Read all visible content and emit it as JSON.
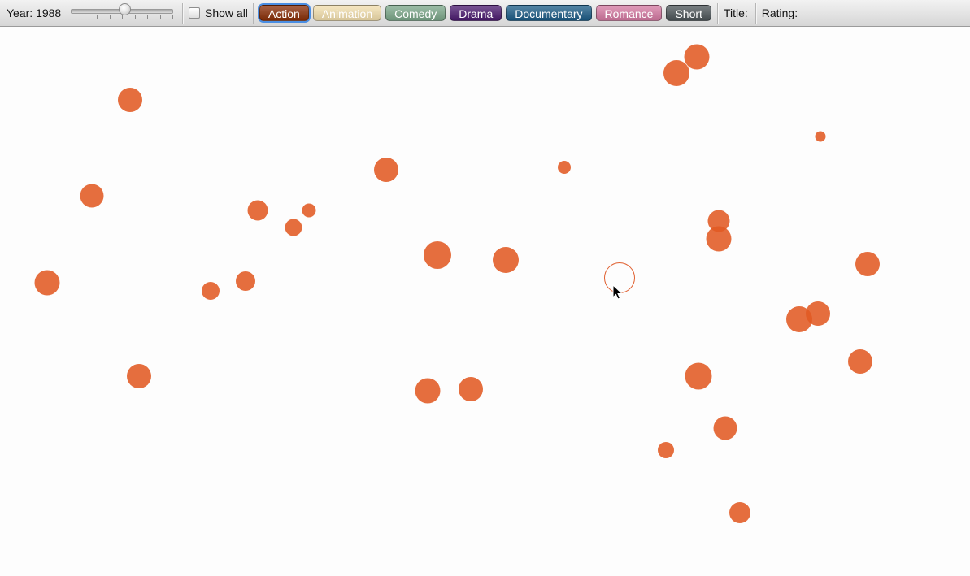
{
  "toolbar": {
    "year_label": "Year: 1988",
    "year_value": 1988,
    "slider_fraction": 0.53,
    "show_all_label": "Show all",
    "show_all_checked": false,
    "title_label": "Title:",
    "rating_label": "Rating:"
  },
  "genres": [
    {
      "label": "Action",
      "bg": "#8a2e06",
      "fg": "#ffffff",
      "active": true
    },
    {
      "label": "Animation",
      "bg": "#f4e0ae",
      "fg": "#ffffff",
      "active": false
    },
    {
      "label": "Comedy",
      "bg": "#7ca88a",
      "fg": "#ffffff",
      "active": false
    },
    {
      "label": "Drama",
      "bg": "#4c1c70",
      "fg": "#ffffff",
      "active": false
    },
    {
      "label": "Documentary",
      "bg": "#1c5c87",
      "fg": "#ffffff",
      "active": false
    },
    {
      "label": "Romance",
      "bg": "#d67aa3",
      "fg": "#ffffff",
      "active": false
    },
    {
      "label": "Short",
      "bg": "#4d5559",
      "fg": "#ffffff",
      "active": false
    }
  ],
  "colors": {
    "dot": "#e15a23",
    "canvas_bg": "#fdfdfd"
  },
  "icons": {
    "cursor": "arrow-pointer-icon"
  }
}
